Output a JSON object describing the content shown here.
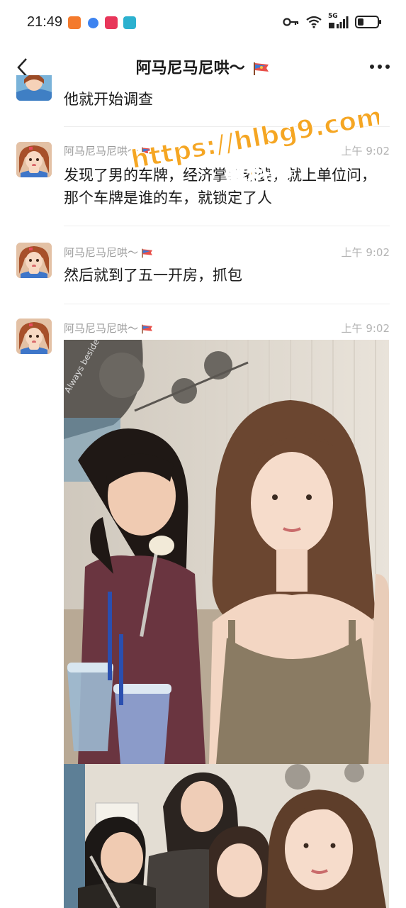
{
  "status_bar": {
    "time": "21:49",
    "network": "5G"
  },
  "header": {
    "title": "阿马尼马尼哄～"
  },
  "messages": [
    {
      "text": "他就开始调查"
    },
    {
      "sender": "阿马尼马尼哄～",
      "time": "上午 9:02",
      "text": "发现了男的车牌，经济掌控老婆，就上单位问，那个车牌是谁的车，就锁定了人"
    },
    {
      "sender": "阿马尼马尼哄～",
      "time": "上午 9:02",
      "text": "然后就到了五一开房，抓包"
    },
    {
      "sender": "阿马尼马尼哄～",
      "time": "上午 9:02"
    }
  ],
  "photo1": {
    "sign_text": "Always beside"
  },
  "watermark": {
    "url": "https://hlbg9.com",
    "brand": "黑料网"
  }
}
